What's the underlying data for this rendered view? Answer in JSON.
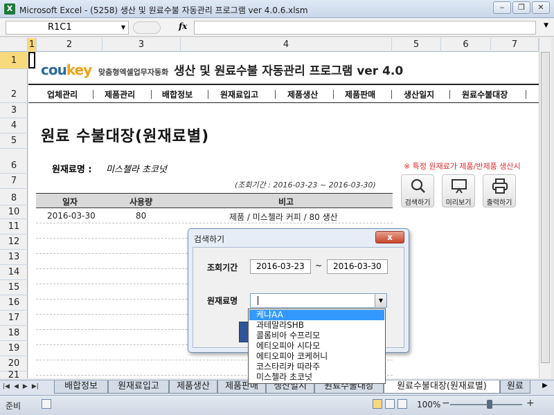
{
  "window": {
    "title": "Microsoft Excel - (5258) 생산 및 원료수불 자동관리 프로그램 ver 4.0.6.xlsm",
    "app_icon": "X",
    "buttons": [
      "‒",
      "❐",
      "✕"
    ]
  },
  "formula_bar": {
    "name_box": "R1C1",
    "fx_label": "fx",
    "formula_value": ""
  },
  "columns": [
    "1",
    "2",
    "3",
    "4",
    "5",
    "6",
    "7"
  ],
  "rows": [
    "1",
    "2",
    "3",
    "4",
    "5",
    "6",
    "7",
    "8",
    "10",
    "11",
    "12",
    "13",
    "14",
    "15",
    "16",
    "17",
    "18",
    "19",
    "20",
    "21"
  ],
  "header": {
    "brand_main": "cou",
    "brand_accent": "key",
    "brand_sub": "맞춤형엑셀업무자동화",
    "title": "생산 및 원료수불 자동관리 프로그램 ver 4.0"
  },
  "menu": [
    "업체관리",
    "제품관리",
    "배합정보",
    "원재료입고",
    "제품생산",
    "제품판매",
    "생산일지",
    "원료수불대장"
  ],
  "page": {
    "heading": "원료 수불대장(원재료별)",
    "material_label": "원재료명 :",
    "material_value": "미스첼라 초코넛",
    "notice": "※ 특정 원재료가 제품/반제품 생산시",
    "period": "(조회기간 : 2016-03-23 ~ 2016-03-30)"
  },
  "tools": [
    {
      "label": "검색하기",
      "icon": "search-icon"
    },
    {
      "label": "미리보기",
      "icon": "monitor-icon"
    },
    {
      "label": "출력하기",
      "icon": "printer-icon"
    }
  ],
  "table": {
    "headers": [
      "일자",
      "사용량",
      "비고"
    ],
    "rows": [
      {
        "date": "2016-03-30",
        "qty": "80",
        "note": "제품 / 미스첼라 커피 / 80 생산"
      }
    ]
  },
  "dialog": {
    "title": "검색하기",
    "close": "x",
    "period_label": "조회기간",
    "date_from": "2016-03-23",
    "tilde": "~",
    "date_to": "2016-03-30",
    "material_label": "원재료명",
    "material_value": "",
    "options": [
      "케냐AA",
      "과테말라SHB",
      "콜롬비아 수프리모",
      "에티오피아 시다모",
      "에티오피아 코케허니",
      "코스타리카 따라주",
      "미스첼라 초코넛"
    ],
    "selected_index": 0
  },
  "sheet_tabs": [
    "배합정보",
    "원재료입고",
    "제품생산",
    "제품판매",
    "생산일지",
    "원료수불대장",
    "원료수불대장(원재료별)",
    "원료"
  ],
  "active_tab_index": 6,
  "status": {
    "mode": "준비",
    "zoom": "100%"
  },
  "colors": {
    "accent": "#2c6a9e",
    "brand_accent": "#f0a11a",
    "notice": "#e02b2b",
    "selection": "#3399ff"
  }
}
